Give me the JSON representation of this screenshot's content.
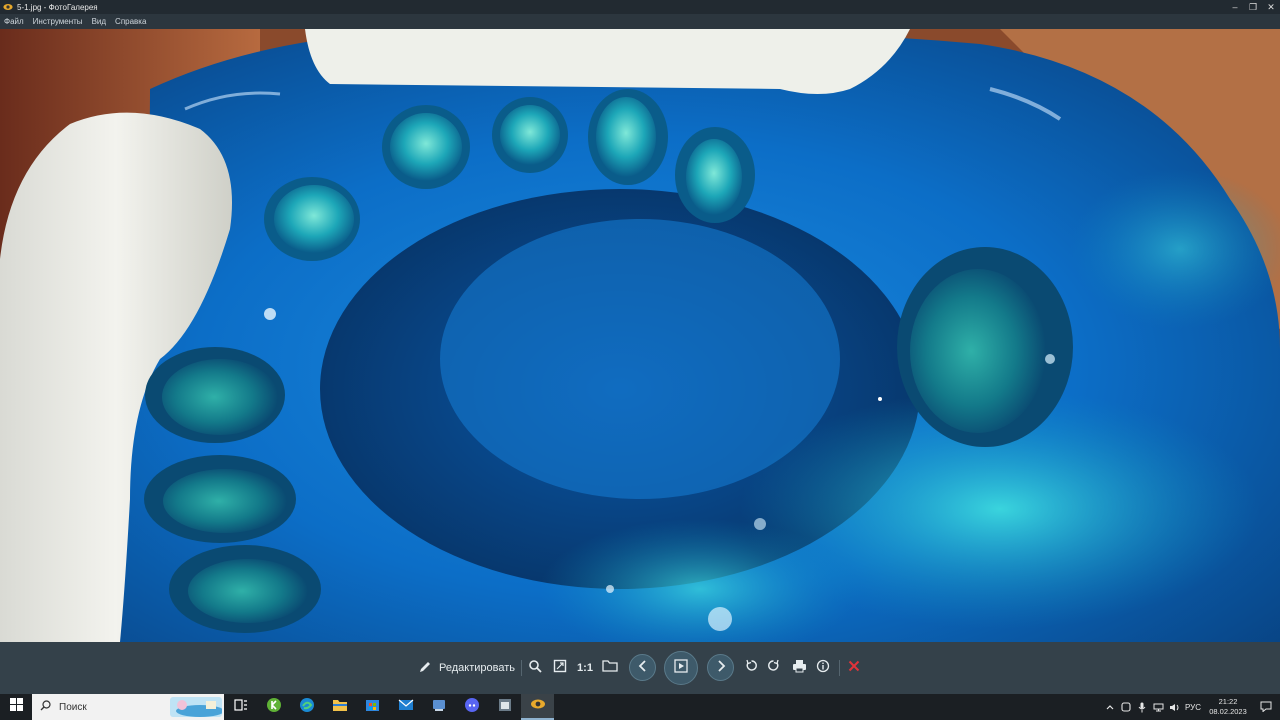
{
  "window": {
    "title": "5-1.jpg - ФотоГалерея",
    "controls": {
      "minimize": "–",
      "restore": "❐",
      "close": "✕"
    }
  },
  "menu": {
    "items": [
      "Файл",
      "Инструменты",
      "Вид",
      "Справка"
    ]
  },
  "toolbar": {
    "edit_label": "Редактировать",
    "one_to_one_label": "1:1",
    "icons": [
      "pencil-icon",
      "zoom-icon",
      "fit-window-icon",
      "one-to-one",
      "folder-icon",
      "prev-icon",
      "slideshow-icon",
      "next-icon",
      "rotate-left-icon",
      "rotate-right-icon",
      "print-icon",
      "info-icon",
      "delete-icon"
    ],
    "accent_delete_color": "#e0333a"
  },
  "taskbar": {
    "search_placeholder": "Поиск",
    "apps": [
      "task-view-icon",
      "app-green-icon",
      "edge-icon",
      "file-explorer-icon",
      "store-icon",
      "mail-icon",
      "app-generic-icon",
      "discord-icon",
      "app-window-icon",
      "photo-gallery-icon"
    ],
    "tray": {
      "language": "РУС",
      "time": "21:22",
      "date": "08.02.2023"
    }
  }
}
